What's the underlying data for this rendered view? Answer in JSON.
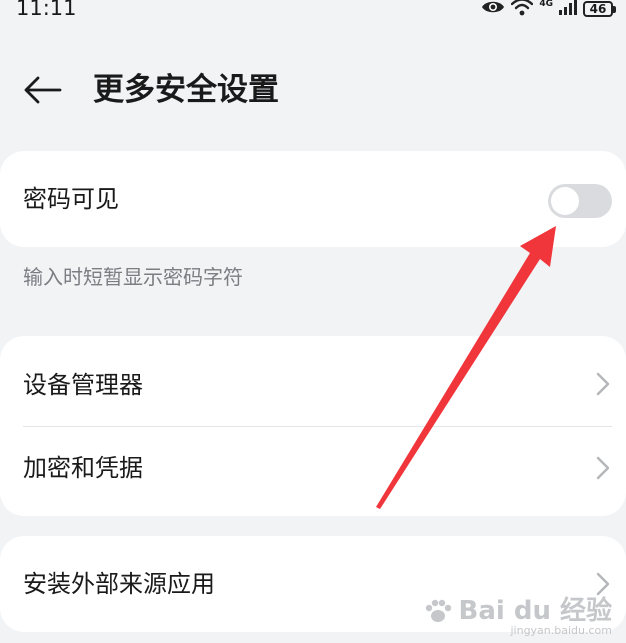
{
  "status_bar": {
    "time": "11:11",
    "network": "4G",
    "battery": "46"
  },
  "header": {
    "title": "更多安全设置"
  },
  "password_visible": {
    "label": "密码可见",
    "enabled": false,
    "hint": "输入时短暂显示密码字符"
  },
  "device_group": {
    "items": [
      {
        "label": "设备管理器"
      },
      {
        "label": "加密和凭据"
      }
    ]
  },
  "external_group": {
    "items": [
      {
        "label": "安装外部来源应用"
      }
    ]
  },
  "annotation": {
    "color": "#f0353b"
  },
  "watermark": {
    "brand": "Bai du 经验",
    "site": "jingyan.baidu.com"
  }
}
